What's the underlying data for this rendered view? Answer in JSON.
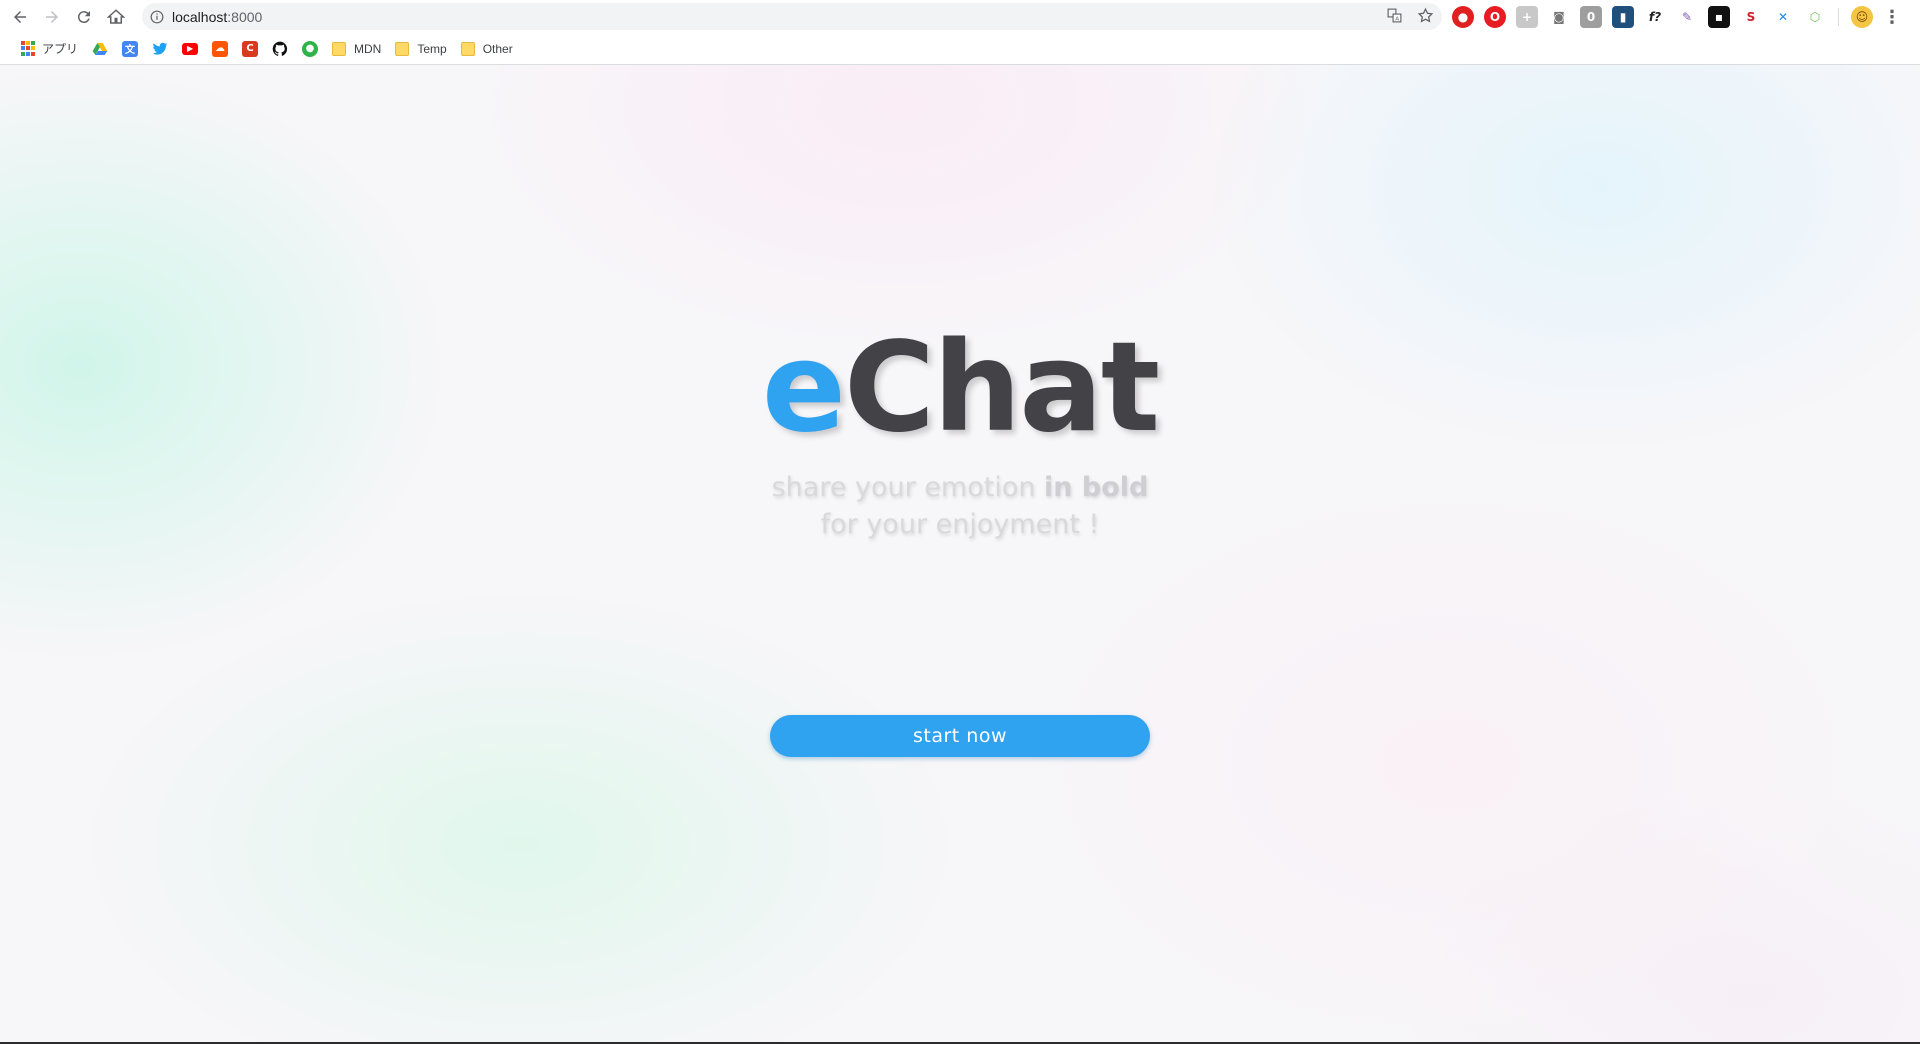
{
  "browser": {
    "url_host": "localhost",
    "url_port": ":8000",
    "bookmarks": [
      {
        "label": "アプリ",
        "icon": "apps-grid-icon"
      },
      {
        "label": "",
        "icon": "google-drive-icon"
      },
      {
        "label": "",
        "icon": "google-translate-icon"
      },
      {
        "label": "",
        "icon": "twitter-icon"
      },
      {
        "label": "",
        "icon": "youtube-icon"
      },
      {
        "label": "",
        "icon": "soundcloud-icon"
      },
      {
        "label": "",
        "icon": "c-icon"
      },
      {
        "label": "",
        "icon": "github-icon"
      },
      {
        "label": "",
        "icon": "green-globe-icon"
      },
      {
        "label": "MDN",
        "icon": "folder-icon"
      },
      {
        "label": "Temp",
        "icon": "folder-icon"
      },
      {
        "label": "Other",
        "icon": "folder-icon"
      }
    ]
  },
  "page": {
    "logo_prefix": "e",
    "logo_rest": "Chat",
    "tagline_line1_normal": "share your emotion ",
    "tagline_line1_bold": "in bold",
    "tagline_line2": "for your enjoyment !",
    "start_button": "start now"
  },
  "colors": {
    "accent": "#2fa2f0",
    "logo_dark": "#434247",
    "tagline": "#d9d9dc"
  }
}
